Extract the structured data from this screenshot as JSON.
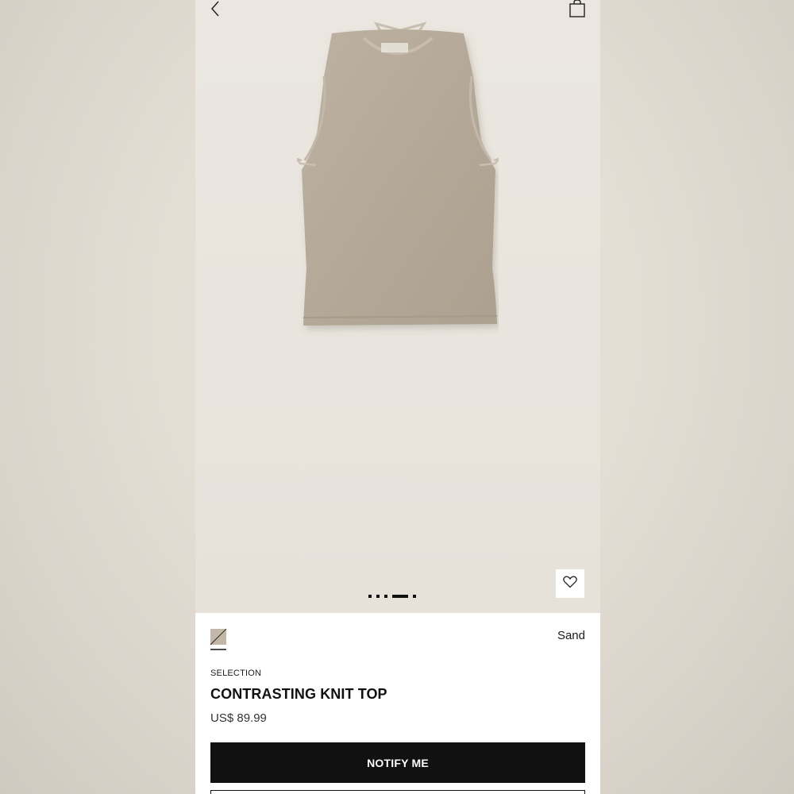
{
  "product": {
    "collection": "SELECTION",
    "title": "CONTRASTING KNIT TOP",
    "price": "US$ 89.99",
    "color": "Sand"
  },
  "actions": {
    "notify_label": "NOTIFY ME"
  },
  "gallery": {
    "image_count": 5,
    "active_index": 3
  },
  "icons": {
    "back": "chevron-left-icon",
    "bag": "shopping-bag-icon",
    "wishlist": "heart-icon",
    "swatch": "color-swatch-icon"
  },
  "colors": {
    "button_bg": "#111111",
    "button_text": "#ffffff",
    "garment": "#b7ac9c",
    "hero_bg": "#e9e5de"
  }
}
